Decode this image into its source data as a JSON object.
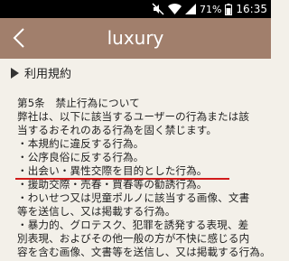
{
  "status_bar": {
    "battery_percent": "71%",
    "time": "16:35"
  },
  "app_bar": {
    "title": "luxury"
  },
  "section": {
    "heading": "利用規約"
  },
  "terms": {
    "lines": [
      "第5条　禁止行為について",
      "弊社は、以下に該当するユーザーの行為または該",
      "当するおそれのある行為を固く禁じます。",
      "・本規約に違反する行為。",
      "・公序良俗に反する行為。",
      "・出会い・異性交際を目的とした行為。",
      "・援助交際・売春・買春等の勧誘行為。",
      "・わいせつ又は児童ポルノに該当する画像、文書",
      "等を送信し、又は掲載する行為。",
      "・暴力的、グロテスク、犯罪を誘発する表現、差",
      "別表現、およびその他一般の方が不快に感じる内",
      "容を含む画像、文書等を送信し、又は掲載する行為。"
    ]
  },
  "colors": {
    "appbar": "#a17f6c",
    "background": "#f3f0e9",
    "highlight_underline": "#d21b1b"
  }
}
